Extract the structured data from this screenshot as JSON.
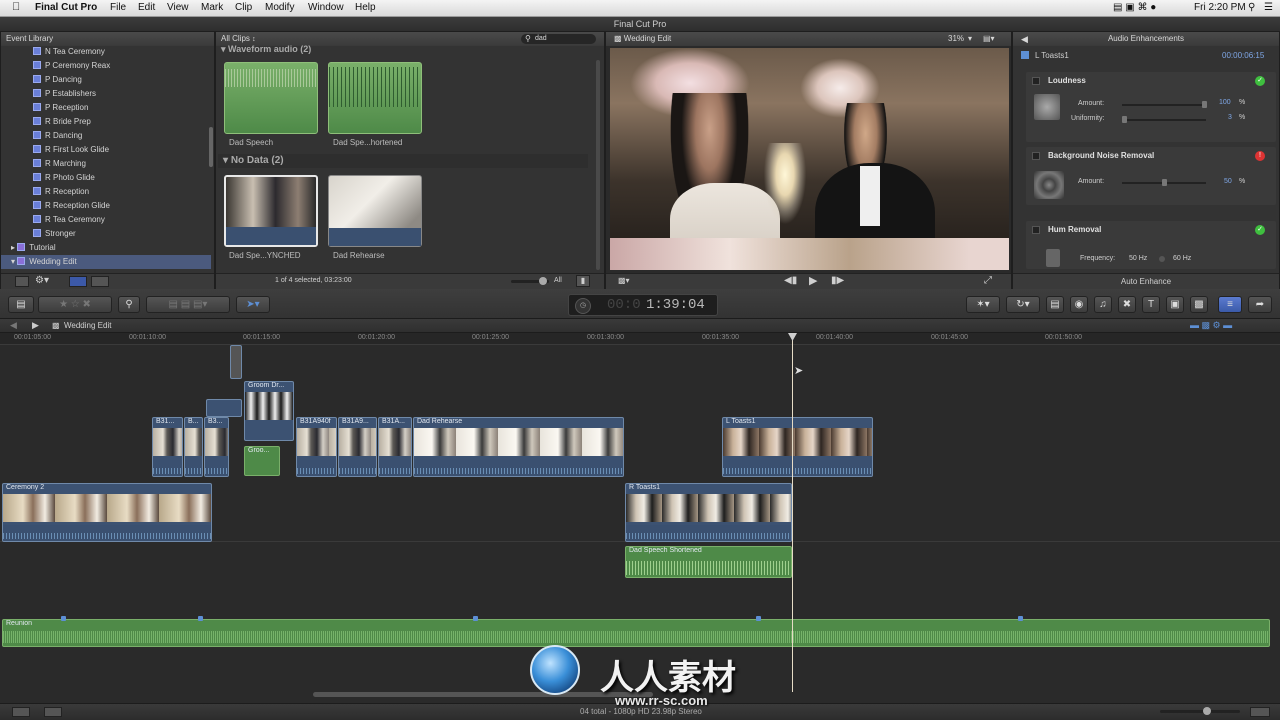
{
  "menubar": {
    "app": "Final Cut Pro",
    "items": [
      "File",
      "Edit",
      "View",
      "Mark",
      "Clip",
      "Modify",
      "Window",
      "Help"
    ],
    "clock": "Fri 2:20 PM"
  },
  "window_title": "Final Cut Pro",
  "event_library": {
    "title": "Event Library",
    "items": [
      "N Tea Ceremony",
      "P Ceremony Reax",
      "P Dancing",
      "P Establishers",
      "P Reception",
      "R Bride Prep",
      "R Dancing",
      "R First Look Glide",
      "R Marching",
      "R Photo Glide",
      "R Reception",
      "R Reception Glide",
      "R Tea Ceremony",
      "Stronger"
    ],
    "folders": [
      "Tutorial",
      "Wedding Edit"
    ]
  },
  "browser": {
    "filter": "All Clips",
    "search": "dad",
    "group1": "Waveform audio",
    "group1_count": "(2)",
    "group2": "No Data",
    "group2_count": "(2)",
    "clips": [
      "Dad Speech",
      "Dad Spe...hortened",
      "Dad Spe...YNCHED",
      "Dad Rehearse"
    ],
    "status": "1 of 4 selected, 03:23:00",
    "all_label": "All"
  },
  "viewer": {
    "title": "Wedding Edit",
    "zoom": "31%"
  },
  "inspector": {
    "title": "Audio Enhancements",
    "clip": "L Toasts1",
    "timecode": "00:00:06:15",
    "loudness": "Loudness",
    "amount_label": "Amount:",
    "amount_value": "100",
    "uniformity_label": "Uniformity:",
    "uniformity_value": "3",
    "bnr": "Background Noise Removal",
    "bnr_amount": "50",
    "hum": "Hum Removal",
    "frequency_label": "Frequency:",
    "freq1": "50 Hz",
    "freq2": "60 Hz",
    "auto_enhance": "Auto Enhance",
    "pct": "%"
  },
  "toolbar": {
    "timecode": "1:39:04",
    "timecode_dim": "00:0"
  },
  "timeline": {
    "project": "Wedding Edit",
    "ruler": [
      "00:01:05:00",
      "00:01:10:00",
      "00:01:15:00",
      "00:01:20:00",
      "00:01:25:00",
      "00:01:30:00",
      "00:01:35:00",
      "00:01:40:00",
      "00:01:45:00",
      "00:01:50:00"
    ],
    "clips": {
      "groom_dr": "Groom Dr...",
      "groo": "Groo...",
      "b31a": "B31...",
      "b": "B...",
      "b3": "B3...",
      "b31a940f": "B31A940f",
      "b31a9": "B31A9...",
      "b31a_2": "B31A...",
      "dad_rehearse": "Dad Rehearse",
      "l_toasts1": "L Toasts1",
      "ceremony2": "Ceremony 2",
      "r_toasts1": "R Toasts1",
      "dad_speech_short": "Dad Speech Shortened",
      "reunion": "Reunion"
    },
    "footer": "04 total - 1080p HD 23.98p Stereo"
  },
  "watermark": {
    "text": "人人素材",
    "url": "www.rr-sc.com"
  }
}
